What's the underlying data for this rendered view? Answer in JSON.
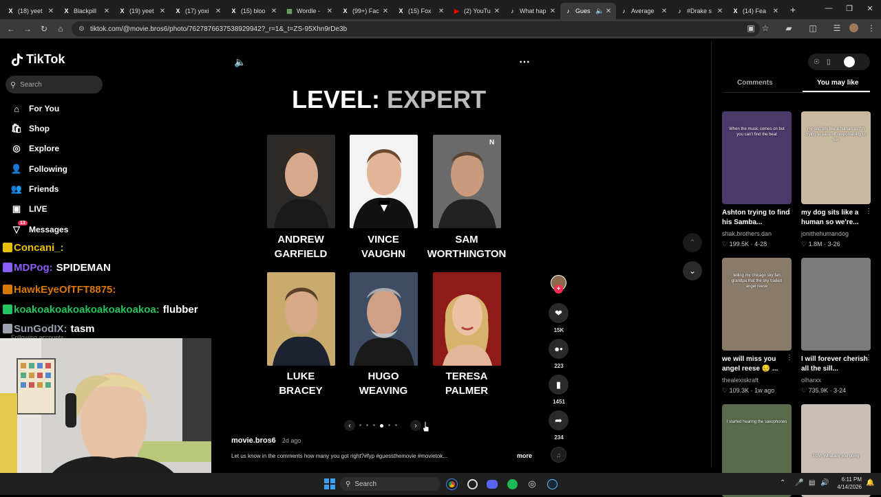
{
  "browser": {
    "tabs": [
      {
        "title": "(18) yeet",
        "icon": "x-icon"
      },
      {
        "title": "Blackpill",
        "icon": "x-icon"
      },
      {
        "title": "(19) yeet",
        "icon": "x-icon"
      },
      {
        "title": "(17) yoxi",
        "icon": "x-icon"
      },
      {
        "title": "(15) bloo",
        "icon": "x-icon"
      },
      {
        "title": "Wordle -",
        "icon": "grid-icon"
      },
      {
        "title": "(99+) Fac",
        "icon": "x-icon"
      },
      {
        "title": "(15) Fox",
        "icon": "x-icon"
      },
      {
        "title": "(2) YouTu",
        "icon": "youtube-icon"
      },
      {
        "title": "What hap",
        "icon": "tiktok-icon"
      },
      {
        "title": "Gues",
        "icon": "tiktok-icon",
        "active": true
      },
      {
        "title": "Average",
        "icon": "tiktok-icon"
      },
      {
        "title": "#Drake s",
        "icon": "tiktok-icon"
      },
      {
        "title": "(14) Fea",
        "icon": "x-icon"
      }
    ],
    "new_tab": "+",
    "url": "tiktok.com/@movie.bros6/photo/7627876637538929942?_r=1&_t=ZS-95Xhn9rDe3b"
  },
  "sidebar": {
    "logo": "TikTok",
    "search_placeholder": "Search",
    "items": [
      {
        "label": "For You",
        "icon": "home-icon"
      },
      {
        "label": "Shop",
        "icon": "shop-icon"
      },
      {
        "label": "Explore",
        "icon": "compass-icon"
      },
      {
        "label": "Following",
        "icon": "following-icon"
      },
      {
        "label": "Friends",
        "icon": "friends-icon"
      },
      {
        "label": "LIVE",
        "icon": "live-icon"
      },
      {
        "label": "Messages",
        "icon": "messages-icon",
        "badge": "13"
      }
    ],
    "following_accounts": "Following accounts"
  },
  "chat": [
    {
      "user": "Concani_:",
      "message": "",
      "color": "#e8c000"
    },
    {
      "user": "MDPog:",
      "message": "SPIDEMAN",
      "color": "#8b5cf6"
    },
    {
      "user": "HawkEyeOfTFT8875:",
      "message": "",
      "color": "#d97706"
    },
    {
      "user": "koakoakoakoakoakoakoakoa:",
      "message": "flubber",
      "color": "#22c55e"
    },
    {
      "user": "SunGodIX:",
      "message": "tasm",
      "color": "#9ca3af"
    }
  ],
  "post": {
    "level_label": "LEVEL:",
    "level_value": "EXPERT",
    "actors": [
      {
        "line1": "ANDREW",
        "line2": "GARFIELD"
      },
      {
        "line1": "VINCE",
        "line2": "VAUGHN"
      },
      {
        "line1": "SAM",
        "line2": "WORTHINGTON"
      },
      {
        "line1": "LUKE",
        "line2": "BRACEY"
      },
      {
        "line1": "HUGO",
        "line2": "WEAVING"
      },
      {
        "line1": "TERESA",
        "line2": "PALMER"
      }
    ],
    "author": "movie.bros6",
    "time": "2d ago",
    "caption": "Let us know in the comments how many you got right?#fyp #guessthemovie #movietok...",
    "more": "more",
    "carousel_total": 6,
    "carousel_active": 4
  },
  "actions": {
    "likes": "15K",
    "comments": "223",
    "saves": "1451",
    "shares": "234"
  },
  "right_panel": {
    "tabs": [
      "Comments",
      "You may like"
    ],
    "active_tab": "You may like",
    "videos": [
      {
        "title": "Ashton trying to find his Samba...",
        "author": "shak.brothers.dan",
        "views": "199.5K",
        "date": "4-28",
        "overlay": "When the music comes on but you can't find the beat"
      },
      {
        "title": "my dog sits like a human so we're...",
        "author": "jonithehumandog",
        "views": "1.8M",
        "date": "3-26",
        "overlay": "my dog sits like a human so I'm trying to pass off responsibility to her"
      },
      {
        "title": "we will miss you angel reese 😔 ...",
        "author": "thealexiskraft",
        "views": "109.3K",
        "date": "1w ago",
        "overlay": "telling my chicago sky fan grandpa that the sky traded angel reese"
      },
      {
        "title": "I will forever cherish all the sill...",
        "author": "olharxx",
        "views": "735.9K",
        "date": "3-24",
        "overlay": ""
      },
      {
        "title": "",
        "author": "",
        "views": "",
        "date": "",
        "overlay": "I started hearing the saxophones"
      },
      {
        "title": "",
        "author": "",
        "views": "",
        "date": "",
        "overlay": "POV: What are you doing"
      }
    ]
  },
  "taskbar": {
    "search": "Search",
    "time": "6:11 PM",
    "date": "4/14/2026"
  }
}
